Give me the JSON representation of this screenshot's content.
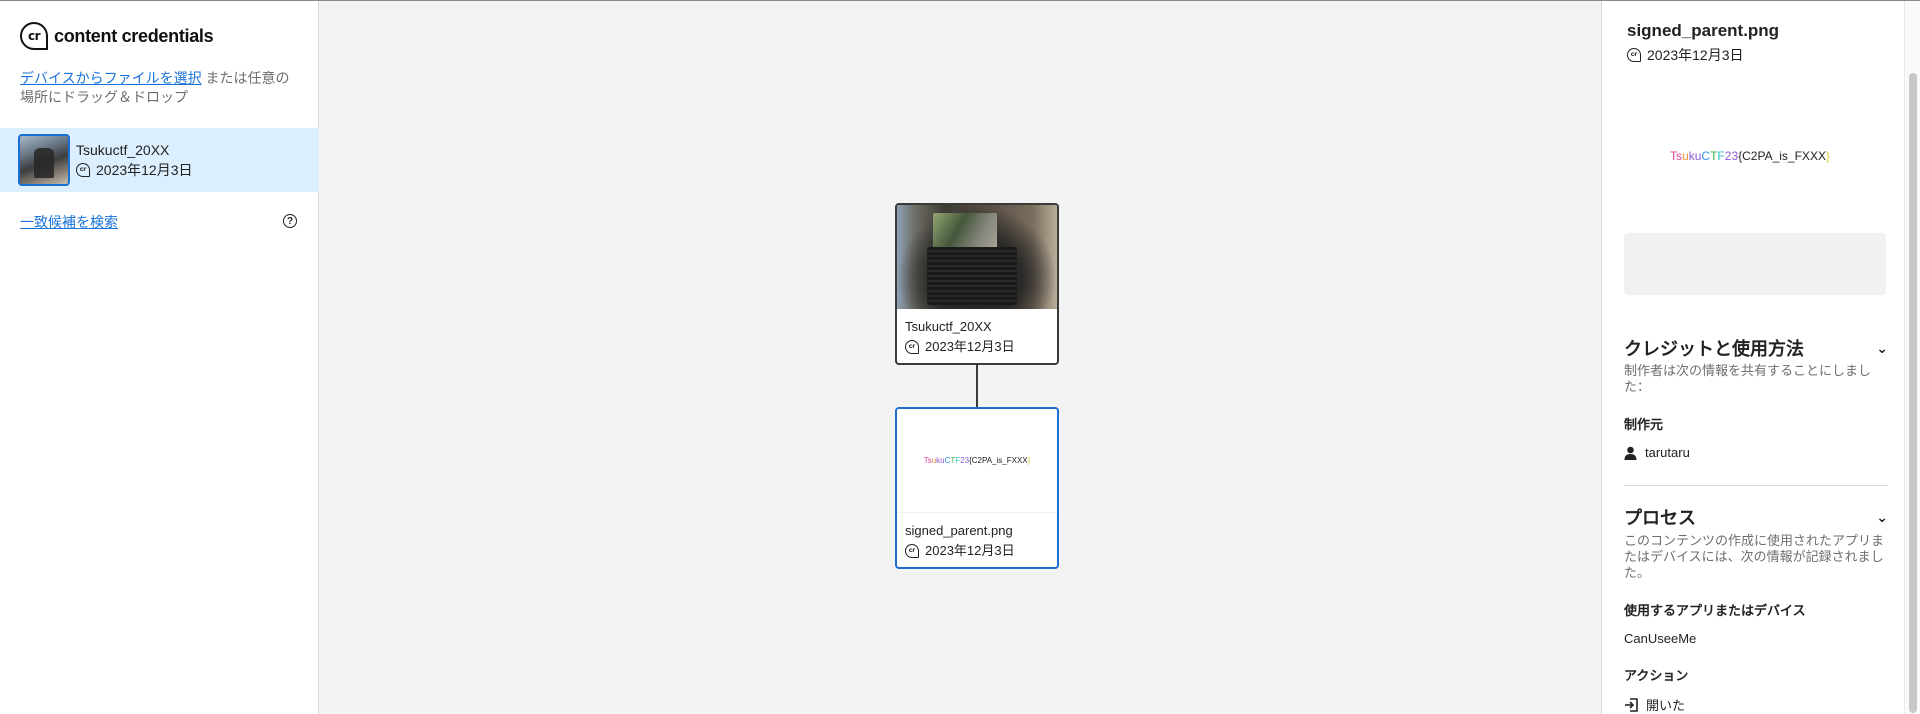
{
  "brand": {
    "mark": "cr",
    "name": "content credentials"
  },
  "sidebar": {
    "select_link": "デバイスからファイルを選択",
    "drop_text": " または任意の場所にドラッグ＆ドロップ",
    "files": [
      {
        "name": "Tsukuctf_20XX",
        "date": "2023年12月3日"
      }
    ],
    "search_link": "一致候補を検索",
    "help": "?"
  },
  "canvas": {
    "nodes": [
      {
        "name": "Tsukuctf_20XX",
        "date": "2023年12月3日"
      },
      {
        "name": "signed_parent.png",
        "date": "2023年12月3日",
        "preview_text": "TsukuCTF23{C2PA_is_FXXX}"
      }
    ]
  },
  "panel": {
    "title": "signed_parent.png",
    "date": "2023年12月3日",
    "preview_text": "TsukuCTF23{C2PA_is_FXXX}",
    "credits": {
      "heading": "クレジットと使用方法",
      "desc": "制作者は次の情報を共有することにしました：",
      "producer_label": "制作元",
      "producer": "tarutaru"
    },
    "process": {
      "heading": "プロセス",
      "desc": "このコンテンツの作成に使用されたアプリまたはデバイスには、次の情報が記録されました。",
      "app_label": "使用するアプリまたはデバイス",
      "app": "CanUseeMe",
      "actions_label": "アクション",
      "action": "開いた"
    }
  },
  "colors": {
    "accent": "#1b6fd1",
    "selected_bg": "#dcefff",
    "link": "#1a73d9"
  }
}
